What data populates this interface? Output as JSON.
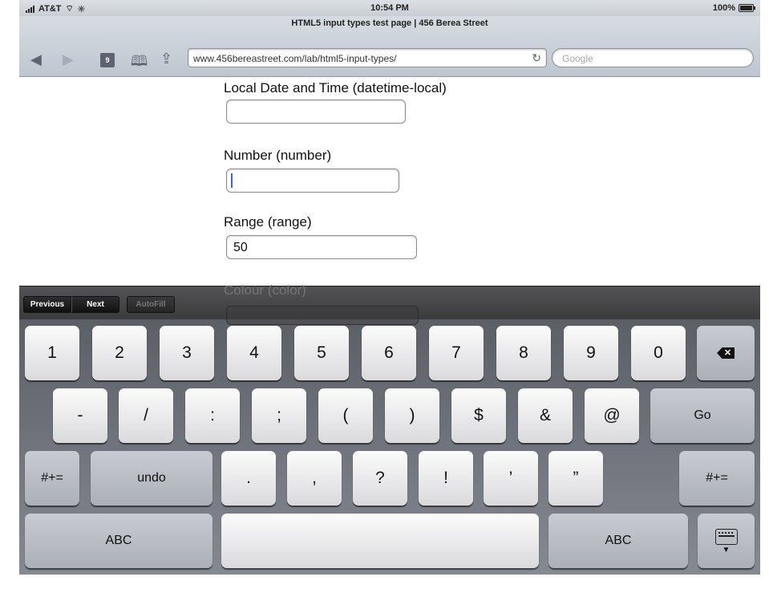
{
  "status_bar": {
    "carrier": "AT&T",
    "time": "10:54 PM",
    "battery": "100%"
  },
  "browser": {
    "page_title": "HTML5 input types test page | 456 Berea Street",
    "tabs_count": "9",
    "url": "www.456bereastreet.com/lab/html5-input-types/",
    "search_placeholder": "Google"
  },
  "form": {
    "fields": [
      {
        "label": "Local Date and Time (datetime-local)",
        "value": ""
      },
      {
        "label": "Number (number)",
        "value": ""
      },
      {
        "label": "Range (range)",
        "value": "50"
      },
      {
        "label": "Colour (color)",
        "value": ""
      }
    ]
  },
  "accessory": {
    "previous": "Previous",
    "next": "Next",
    "autofill": "AutoFill"
  },
  "keyboard": {
    "row1": [
      "1",
      "2",
      "3",
      "4",
      "5",
      "6",
      "7",
      "8",
      "9",
      "0"
    ],
    "row2": [
      "-",
      "/",
      ":",
      ";",
      "(",
      ")",
      "$",
      "&",
      "@"
    ],
    "go": "Go",
    "row3_left": "#+=",
    "undo": "undo",
    "row3": [
      ".",
      ",",
      "?",
      "!",
      "’",
      "”"
    ],
    "row3_right": "#+=",
    "abc_left": "ABC",
    "abc_right": "ABC",
    "icons": [
      "delete-icon",
      "hide-keyboard-icon"
    ]
  }
}
